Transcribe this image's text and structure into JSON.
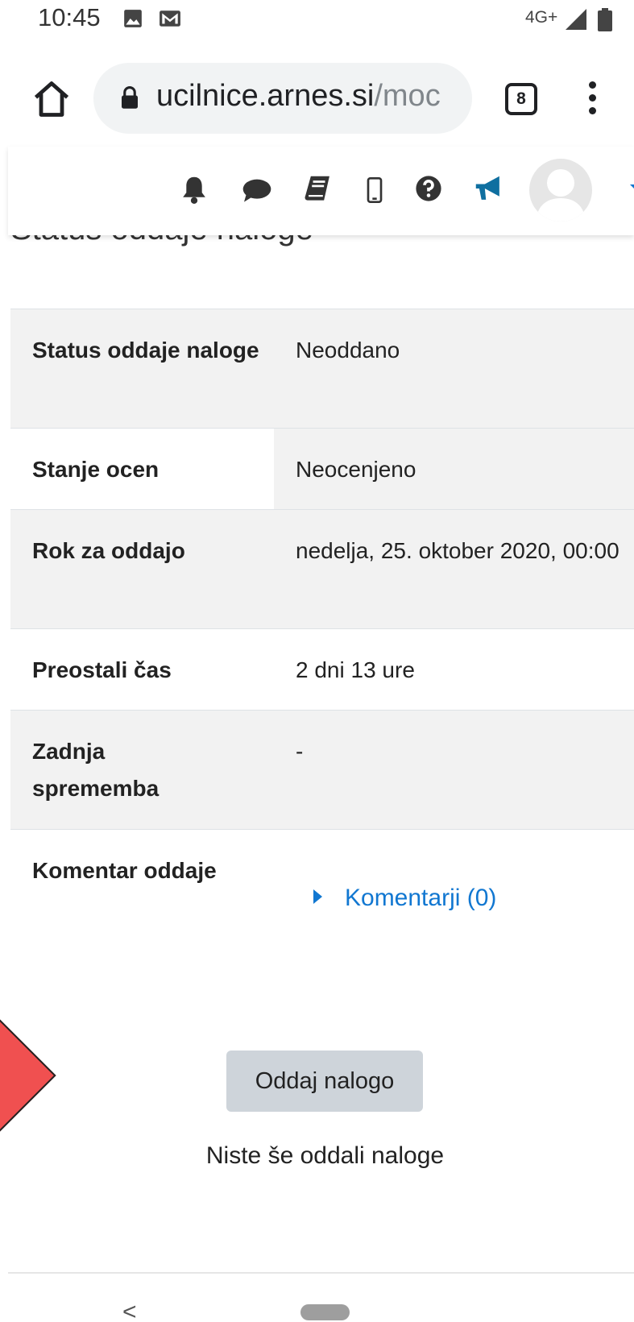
{
  "status_bar": {
    "time": "10:45",
    "icons": [
      "image-icon",
      "gmail-icon"
    ],
    "network": "4G+",
    "system_icons": [
      "signal-icon",
      "battery-icon"
    ]
  },
  "browser": {
    "url_main": "ucilnice.arnes.si",
    "url_dim": "/moc",
    "tab_count": "8"
  },
  "navbar": {
    "icons": [
      "bell-icon",
      "chat-icon",
      "book-icon",
      "mobile-icon",
      "help-icon",
      "megaphone-icon",
      "avatar",
      "chevron-down-icon"
    ],
    "accent_color": "#0f6fa0"
  },
  "page": {
    "heading": "Status oddaje naloge"
  },
  "status_table": {
    "rows": [
      {
        "label": "Status oddaje naloge",
        "value": "Neoddano"
      },
      {
        "label": "Stanje ocen",
        "value": "Neocenjeno"
      },
      {
        "label": "Rok za oddajo",
        "value": "nedelja, 25. oktober 2020, 00:00"
      },
      {
        "label": "Preostali čas",
        "value": "2 dni 13 ure"
      },
      {
        "label": "Zadnja sprememba",
        "value": "-"
      },
      {
        "label": "Komentar oddaje",
        "value": "Komentarji (0)"
      }
    ]
  },
  "submission": {
    "button_label": "Oddaj nalogo",
    "status_text": "Niste še oddali naloge"
  },
  "system_nav": {
    "back": "<"
  },
  "colors": {
    "link": "#1177d1",
    "row_gray": "#f2f2f2",
    "button_bg": "#ced4da",
    "marker": "#f05050"
  }
}
